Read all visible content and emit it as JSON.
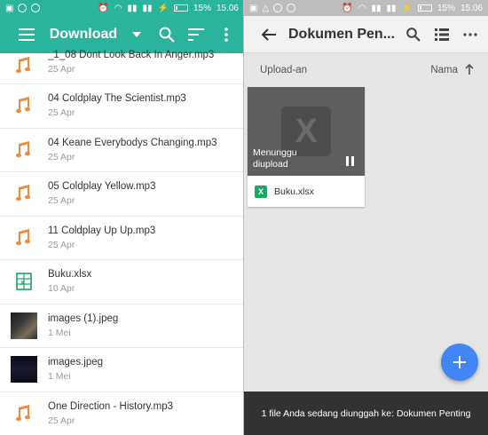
{
  "left": {
    "status": {
      "battery": "15%",
      "time": "15.06"
    },
    "toolbar": {
      "title": "Download"
    },
    "files": [
      {
        "name": "_1_08 Dont Look Back In Anger.mp3",
        "date": "25 Apr",
        "icon": "music-note-icon"
      },
      {
        "name": "04 Coldplay The Scientist.mp3",
        "date": "25 Apr",
        "icon": "music-note-icon"
      },
      {
        "name": "04 Keane Everybodys Changing.mp3",
        "date": "25 Apr",
        "icon": "music-note-icon"
      },
      {
        "name": "05 Coldplay Yellow.mp3",
        "date": "25 Apr",
        "icon": "music-note-icon"
      },
      {
        "name": "11 Coldplay Up Up.mp3",
        "date": "25 Apr",
        "icon": "music-note-icon"
      },
      {
        "name": "Buku.xlsx",
        "date": "10 Apr",
        "icon": "spreadsheet-icon"
      },
      {
        "name": "images (1).jpeg",
        "date": "1 Mei",
        "icon": "image-thumbnail"
      },
      {
        "name": "images.jpeg",
        "date": "1 Mei",
        "icon": "image-thumbnail"
      },
      {
        "name": "One Direction - History.mp3",
        "date": "25 Apr",
        "icon": "music-note-icon"
      }
    ]
  },
  "right": {
    "status": {
      "battery": "15%",
      "time": "15.06"
    },
    "toolbar": {
      "title": "Dokumen Pen..."
    },
    "sort": {
      "left_label": "Upload-an",
      "right_label": "Nama"
    },
    "card": {
      "status_line1": "Menunggu",
      "status_line2": "diupload",
      "name": "Buku.xlsx",
      "badge": "X",
      "preview_letter": "X"
    },
    "snackbar": "1 file Anda sedang diunggah ke: Dokumen Penting"
  },
  "colors": {
    "teal": "#2ab49b",
    "music_orange": "#f08a3c",
    "excel_green": "#1fa463",
    "fab_blue": "#4285f4"
  }
}
